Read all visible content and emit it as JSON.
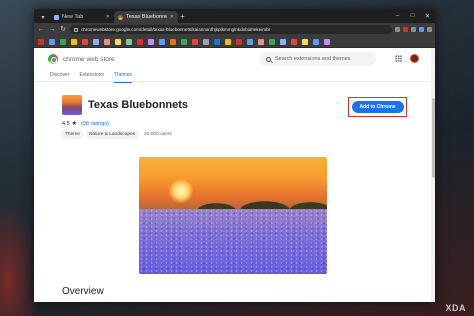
{
  "browser": {
    "tabs": [
      {
        "label": "New Tab",
        "active": false
      },
      {
        "label": "Texas Bluebonnets",
        "active": true
      }
    ],
    "new_tab_glyph": "+",
    "address": "chromewebstore.google.com/detail/texas-bluebonnets/kaiannanfhjkplkmmglnkdobiahekeimbl",
    "window_controls": [
      "–",
      "□",
      "✕"
    ]
  },
  "store": {
    "name": "chrome web store",
    "search_placeholder": "Search extensions and themes",
    "nav": [
      "Discover",
      "Extensions",
      "Themes"
    ],
    "active_nav": "Themes"
  },
  "item": {
    "title": "Texas Bluebonnets",
    "rating_value": "4.5",
    "rating_count": "(98 ratings)",
    "chips": [
      "Theme",
      "Nature & Landscapes"
    ],
    "users": "20,000 users",
    "add_button": "Add to Chrome",
    "section_heading": "Overview"
  },
  "colors": {
    "accent": "#1a73e8",
    "highlight_frame": "#d93025"
  },
  "watermark": "XDA"
}
